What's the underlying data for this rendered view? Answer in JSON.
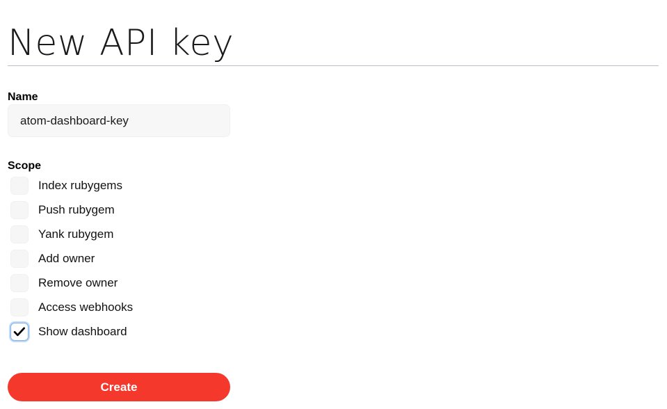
{
  "page": {
    "title": "New API key"
  },
  "form": {
    "name": {
      "label": "Name",
      "value": "atom-dashboard-key",
      "placeholder": ""
    },
    "scope": {
      "label": "Scope",
      "options": [
        {
          "label": "Index rubygems",
          "checked": false
        },
        {
          "label": "Push rubygem",
          "checked": false
        },
        {
          "label": "Yank rubygem",
          "checked": false
        },
        {
          "label": "Add owner",
          "checked": false
        },
        {
          "label": "Remove owner",
          "checked": false
        },
        {
          "label": "Access webhooks",
          "checked": false
        },
        {
          "label": "Show dashboard",
          "checked": true
        }
      ]
    },
    "submit": {
      "label": "Create"
    }
  },
  "colors": {
    "accent": "#f4392c",
    "divider": "#bcbcc4",
    "input_background": "#f7f7f8",
    "checkbox_background": "#f6f6f7",
    "checkbox_focus_border": "#7fb2e8"
  }
}
